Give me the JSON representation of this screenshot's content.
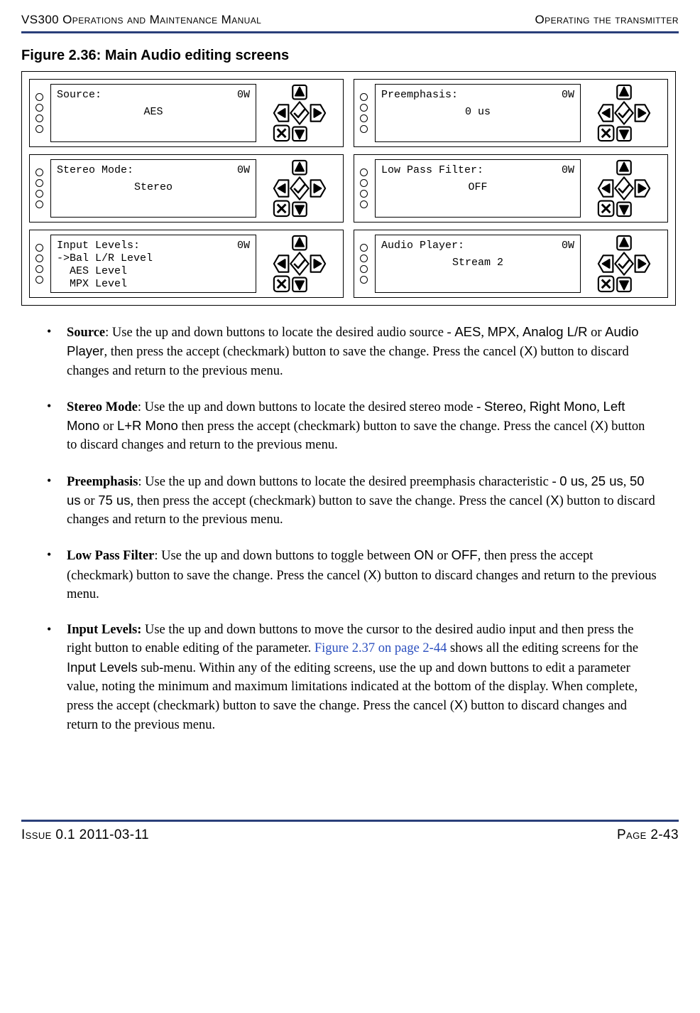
{
  "header": {
    "left": "VS300 Operations and Maintenance Manual",
    "right": "Operating the transmitter"
  },
  "figure": {
    "caption": "Figure 2.36: Main Audio editing screens"
  },
  "screens": [
    {
      "title": "Source:",
      "right": "0W",
      "value": "AES",
      "lines": []
    },
    {
      "title": "Preemphasis:",
      "right": "0W",
      "value": "0 us",
      "lines": []
    },
    {
      "title": "Stereo Mode:",
      "right": "0W",
      "value": "Stereo",
      "lines": []
    },
    {
      "title": "Low Pass Filter:",
      "right": "0W",
      "value": "OFF",
      "lines": []
    },
    {
      "title": "Input Levels:",
      "right": "0W",
      "value": "",
      "lines": [
        "->Bal L/R Level",
        "  AES Level",
        "  MPX Level"
      ]
    },
    {
      "title": "Audio Player:",
      "right": "0W",
      "value": "Stream 2",
      "lines": []
    }
  ],
  "bullets": {
    "source": {
      "term": "Source",
      "pre": ": Use the up and down buttons to locate the desired audio source - ",
      "opts": [
        "AES",
        "MPX",
        "Analog L/R",
        "Audio Player"
      ],
      "post": ", then press the accept (checkmark) button to save the change. Press the cancel (",
      "xchar": "X",
      "tail": ") button to discard changes and return to the previous menu."
    },
    "stereo": {
      "term": "Stereo Mode",
      "pre": ": Use the up and down buttons to locate the desired stereo mode - ",
      "opts": [
        "Stereo",
        "Right Mono",
        "Left Mono",
        "L+R Mono"
      ],
      "post": " then press the accept (checkmark) button to save the change. Press the cancel (",
      "xchar": "X",
      "tail": ") button to discard changes and return to the previous menu."
    },
    "preemph": {
      "term": "Preemphasis",
      "pre": ": Use the up and down buttons to locate the desired preemphasis characteristic - ",
      "opts": [
        "0 us",
        "25 us",
        "50 us",
        "75 us"
      ],
      "post": ", then press the accept (checkmark) button to save the change. Press the cancel (",
      "xchar": "X",
      "tail": ") button to discard changes and return to the previous menu."
    },
    "lpf": {
      "term": "Low Pass Filter",
      "pre": ": Use the up and down buttons to toggle between ",
      "opts": [
        "ON",
        "OFF"
      ],
      "post": ", then press the accept (checkmark) button to save the change. Press the cancel (",
      "xchar": "X",
      "tail": ") button to discard changes and return to the previous menu."
    },
    "input": {
      "term": "Input Levels:",
      "pre": " Use the up and down buttons to move the cursor to the desired audio input and then press the right button to enable editing of the parameter. ",
      "xref": "Figure 2.37 on page 2-44",
      "mid1": " shows all the editing screens for the ",
      "sub": "Input Levels",
      "mid2": " sub-menu. Within any of the editing screens, use the up and down buttons to edit a parameter value, noting the minimum and maximum limitations indicated at the bottom of the display. When complete, press the accept (checkmark) button to save the change. Press the cancel (",
      "xchar": "X",
      "tail": ") button to discard changes and return to the previous menu."
    }
  },
  "footer": {
    "left": "Issue 0.1  2011-03-11",
    "right": "Page 2-43"
  }
}
